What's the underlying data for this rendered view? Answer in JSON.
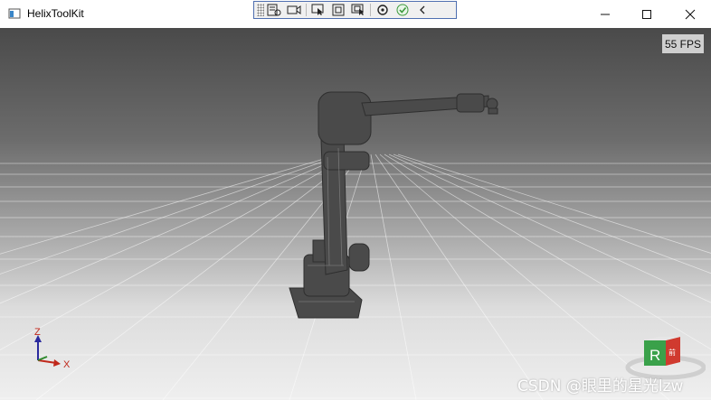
{
  "window": {
    "title": "HelixToolKit"
  },
  "viewport": {
    "fps_label": "55 FPS",
    "axes": {
      "z_label": "Z",
      "x_label": "X"
    },
    "view_cube": {
      "face_label": "R",
      "side_label": "前"
    }
  },
  "watermark": {
    "text": "CSDN @眼里的星光lzw"
  },
  "colors": {
    "accent_axis_z": "#2b2b9e",
    "accent_axis_x": "#c0281b",
    "cube_face": "#3aa14a",
    "cube_side": "#d03a2f"
  }
}
